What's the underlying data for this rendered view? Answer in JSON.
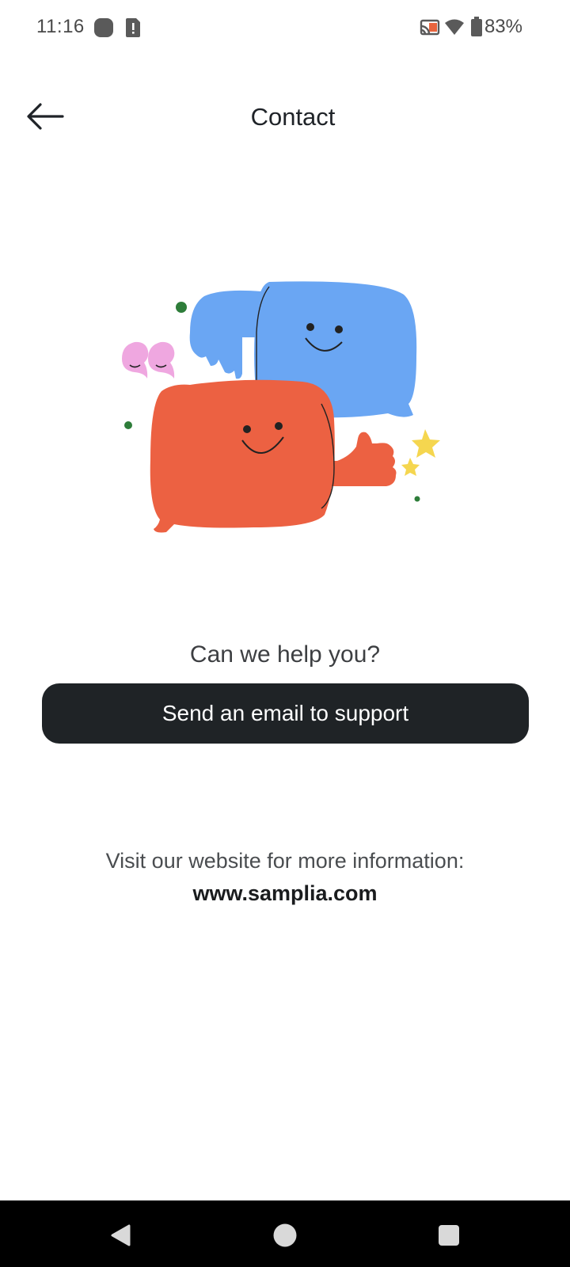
{
  "status_bar": {
    "time": "11:16",
    "battery_percent": "83%"
  },
  "header": {
    "title": "Contact"
  },
  "content": {
    "help_heading": "Can we help you?",
    "email_button_label": "Send an email to support",
    "website_info": "Visit our website for more information:",
    "website_url": "www.samplia.com"
  },
  "colors": {
    "button_bg": "#1f2326",
    "blue_bubble": "#6aa6f3",
    "orange_bubble": "#ec6142",
    "pink_quote": "#efa7e0",
    "star": "#f5d64f",
    "dot": "#2e7d3a"
  },
  "icons": {
    "back": "arrow-left-icon",
    "cast": "cast-icon",
    "wifi": "wifi-icon",
    "battery": "battery-icon",
    "nav_back": "triangle-back-icon",
    "nav_home": "circle-home-icon",
    "nav_recents": "square-recents-icon"
  }
}
